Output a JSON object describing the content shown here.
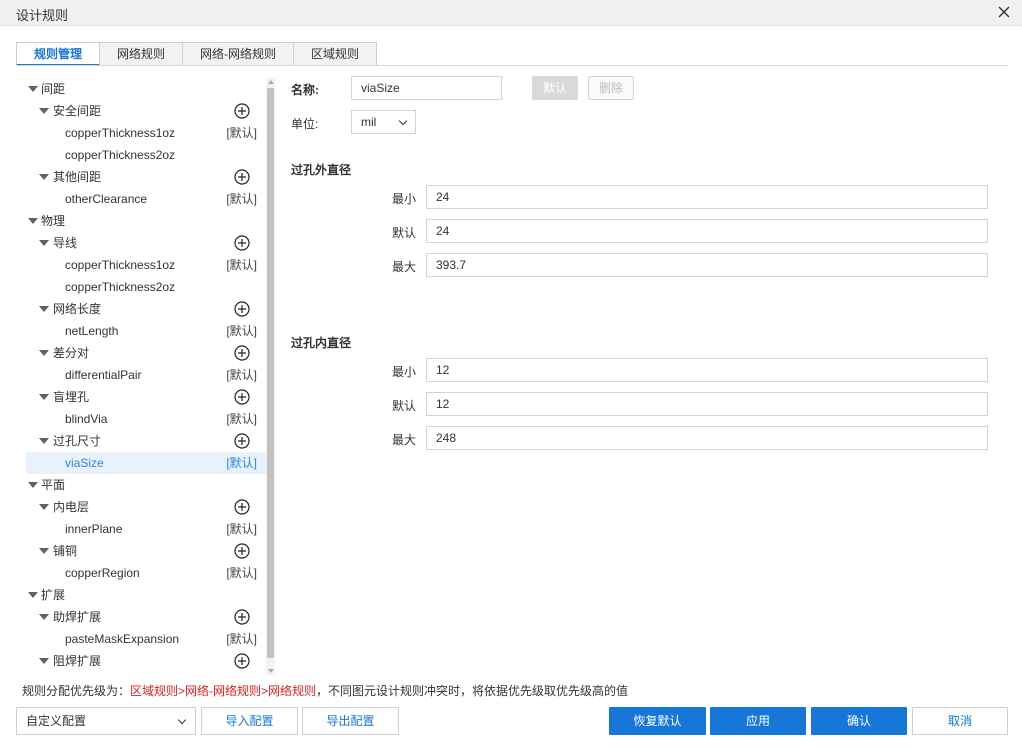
{
  "window": {
    "title": "设计规则"
  },
  "tabs": [
    "规则管理",
    "网络规则",
    "网络-网络规则",
    "区域规则"
  ],
  "tree": [
    {
      "level": 0,
      "label": "间距",
      "expanded": true
    },
    {
      "level": 1,
      "label": "安全间距",
      "expanded": true,
      "add": true
    },
    {
      "level": 2,
      "label": "copperThickness1oz",
      "tag": "[默认]"
    },
    {
      "level": 2,
      "label": "copperThickness2oz",
      "tag": ""
    },
    {
      "level": 1,
      "label": "其他间距",
      "expanded": true,
      "add": true
    },
    {
      "level": 2,
      "label": "otherClearance",
      "tag": "[默认]"
    },
    {
      "level": 0,
      "label": "物理",
      "expanded": true
    },
    {
      "level": 1,
      "label": "导线",
      "expanded": true,
      "add": true
    },
    {
      "level": 2,
      "label": "copperThickness1oz",
      "tag": "[默认]"
    },
    {
      "level": 2,
      "label": "copperThickness2oz",
      "tag": ""
    },
    {
      "level": 1,
      "label": "网络长度",
      "expanded": true,
      "add": true
    },
    {
      "level": 2,
      "label": "netLength",
      "tag": "[默认]"
    },
    {
      "level": 1,
      "label": "差分对",
      "expanded": true,
      "add": true
    },
    {
      "level": 2,
      "label": "differentialPair",
      "tag": "[默认]"
    },
    {
      "level": 1,
      "label": "盲埋孔",
      "expanded": true,
      "add": true
    },
    {
      "level": 2,
      "label": "blindVia",
      "tag": "[默认]"
    },
    {
      "level": 1,
      "label": "过孔尺寸",
      "expanded": true,
      "add": true
    },
    {
      "level": 2,
      "label": "viaSize",
      "tag": "[默认]",
      "selected": true
    },
    {
      "level": 0,
      "label": "平面",
      "expanded": true
    },
    {
      "level": 1,
      "label": "内电层",
      "expanded": true,
      "add": true
    },
    {
      "level": 2,
      "label": "innerPlane",
      "tag": "[默认]"
    },
    {
      "level": 1,
      "label": "铺铜",
      "expanded": true,
      "add": true
    },
    {
      "level": 2,
      "label": "copperRegion",
      "tag": "[默认]"
    },
    {
      "level": 0,
      "label": "扩展",
      "expanded": true
    },
    {
      "level": 1,
      "label": "助焊扩展",
      "expanded": true,
      "add": true
    },
    {
      "level": 2,
      "label": "pasteMaskExpansion",
      "tag": "[默认]"
    },
    {
      "level": 1,
      "label": "阻焊扩展",
      "expanded": true,
      "add": true
    }
  ],
  "form": {
    "name_label": "名称:",
    "name_value": "viaSize",
    "default_btn": "默认",
    "delete_btn": "删除",
    "unit_label": "单位:",
    "unit_value": "mil",
    "outer": {
      "title": "过孔外直径",
      "min_label": "最小",
      "min": "24",
      "def_label": "默认",
      "def": "24",
      "max_label": "最大",
      "max": "393.7"
    },
    "inner": {
      "title": "过孔内直径",
      "min_label": "最小",
      "min": "12",
      "def_label": "默认",
      "def": "12",
      "max_label": "最大",
      "max": "248"
    }
  },
  "priority": {
    "prefix": "规则分配优先级为：",
    "order": "区域规则>网络-网络规则>网络规则",
    "suffix": "，不同图元设计规则冲突时，将依据优先级取优先级高的值"
  },
  "footer": {
    "config_select": "自定义配置",
    "import": "导入配置",
    "export": "导出配置",
    "restore": "恢复默认",
    "apply": "应用",
    "ok": "确认",
    "cancel": "取消"
  },
  "colors": {
    "accent": "#1677d9",
    "priority_red": "#e02020"
  }
}
